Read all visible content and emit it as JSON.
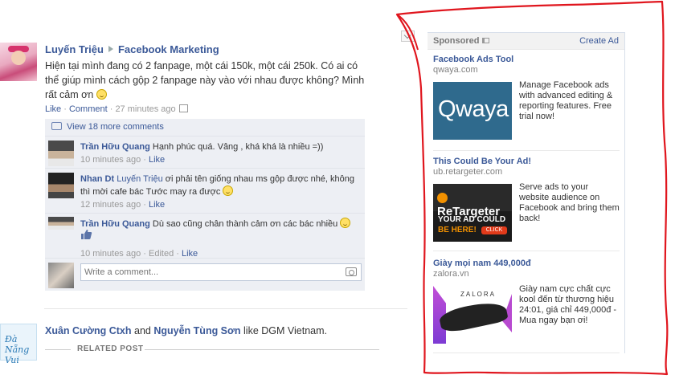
{
  "story": {
    "author": "Luyến Triệu",
    "target": "Facebook Marketing",
    "text": "Hiện tại mình đang có 2 fanpage, một cái 150k, một cái 250k. Có ai có thể giúp mình cách gộp 2 fanpage này vào với nhau được không? Mình rất cảm ơn",
    "like": "Like",
    "comment": "Comment",
    "time": "27 minutes ago",
    "view_more": "View 18 more comments",
    "comments": [
      {
        "author": "Trần Hữu Quang",
        "text": "Hạnh phúc quá. Vâng , khá khá là nhiều =))",
        "time": "10 minutes ago",
        "like": "Like"
      },
      {
        "author": "Nhan Dt",
        "mention": "Luyến Triệu",
        "text": "ơi phải tên giống nhau ms gộp được nhé, không thì mời cafe bác Tước may ra được",
        "time": "12 minutes ago",
        "like": "Like"
      },
      {
        "author": "Trần Hữu Quang",
        "text": "Dù sao cũng chân thành cảm ơn các bác nhiều",
        "time": "10 minutes ago",
        "edited": "Edited",
        "like": "Like"
      }
    ],
    "write_placeholder": "Write a comment..."
  },
  "story2": {
    "person1": "Xuân Cường Ctxh",
    "and": "and",
    "person2": "Nguyễn Tùng Sơn",
    "action": "like DGM Vietnam.",
    "related": "RELATED POST",
    "avatar_text": "Đà Nẵng Vui"
  },
  "ads": {
    "header": "Sponsored",
    "create": "Create Ad",
    "items": [
      {
        "title": "Facebook Ads Tool",
        "domain": "qwaya.com",
        "desc": "Manage Facebook ads with advanced editing & reporting features. Free trial now!",
        "logo": "Qwaya"
      },
      {
        "title": "This Could Be Your Ad!",
        "domain": "ub.retargeter.com",
        "desc": "Serve ads to your website audience on Facebook and bring them back!",
        "logo": "ReTargeter",
        "line1": "YOUR AD COULD",
        "line2": "BE HERE!",
        "btn": "CLICK"
      },
      {
        "title": "Giày mọi nam 449,000đ",
        "domain": "zalora.vn",
        "desc": "Giày nam cực chất cực kool đến từ thương hiệu 24:01, giá chỉ 449,000đ - Mua ngay bạn ơi!",
        "logo": "ZALORA"
      }
    ]
  },
  "colors": {
    "link": "#3b5998",
    "annotation": "#e0161e",
    "comment_bg": "#edeff4"
  }
}
